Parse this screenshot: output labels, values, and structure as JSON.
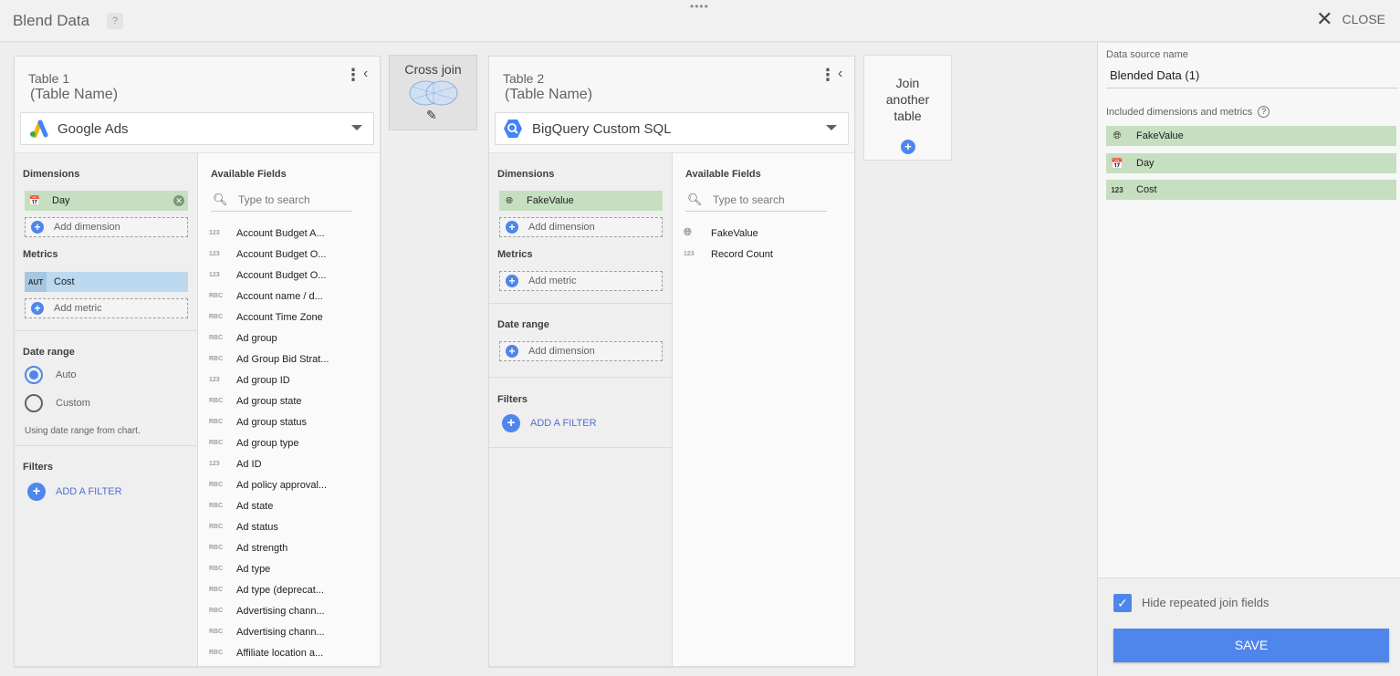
{
  "header": {
    "title": "Blend Data",
    "help_label": "?",
    "grip": "••••",
    "close_label": "CLOSE"
  },
  "table1": {
    "label": "Table 1",
    "name": "(Table Name)",
    "data_source": "Google Ads",
    "dimensions_label": "Dimensions",
    "dimensions": [
      {
        "label": "Day"
      }
    ],
    "add_dimension_label": "Add dimension",
    "metrics_label": "Metrics",
    "metrics": [
      {
        "type": "AUT",
        "label": "Cost"
      }
    ],
    "add_metric_label": "Add metric",
    "date_range_label": "Date range",
    "date_range_options": [
      "Auto",
      "Custom"
    ],
    "date_range_selected": "Auto",
    "date_range_hint": "Using date range from chart.",
    "filters_label": "Filters",
    "add_filter_label": "ADD A FILTER",
    "available_fields_label": "Available Fields",
    "search_placeholder": "Type to search",
    "fields": [
      {
        "type": "123",
        "name": "Account Budget A..."
      },
      {
        "type": "123",
        "name": "Account Budget O..."
      },
      {
        "type": "123",
        "name": "Account Budget O..."
      },
      {
        "type": "RBC",
        "name": "Account name / d..."
      },
      {
        "type": "RBC",
        "name": "Account Time Zone"
      },
      {
        "type": "RBC",
        "name": "Ad group"
      },
      {
        "type": "RBC",
        "name": "Ad Group Bid Strat..."
      },
      {
        "type": "123",
        "name": "Ad group ID"
      },
      {
        "type": "RBC",
        "name": "Ad group state"
      },
      {
        "type": "RBC",
        "name": "Ad group status"
      },
      {
        "type": "RBC",
        "name": "Ad group type"
      },
      {
        "type": "123",
        "name": "Ad ID"
      },
      {
        "type": "RBC",
        "name": "Ad policy approval..."
      },
      {
        "type": "RBC",
        "name": "Ad state"
      },
      {
        "type": "RBC",
        "name": "Ad status"
      },
      {
        "type": "RBC",
        "name": "Ad strength"
      },
      {
        "type": "RBC",
        "name": "Ad type"
      },
      {
        "type": "RBC",
        "name": "Ad type (deprecat..."
      },
      {
        "type": "RBC",
        "name": "Advertising chann..."
      },
      {
        "type": "RBC",
        "name": "Advertising chann..."
      },
      {
        "type": "RBC",
        "name": "Affiliate location a..."
      }
    ]
  },
  "join": {
    "label": "Cross join"
  },
  "table2": {
    "label": "Table 2",
    "name": "(Table Name)",
    "data_source": "BigQuery Custom SQL",
    "dimensions_label": "Dimensions",
    "dimensions": [
      {
        "label": "FakeValue"
      }
    ],
    "add_dimension_label": "Add dimension",
    "metrics_label": "Metrics",
    "add_metric_label": "Add metric",
    "date_range_label": "Date range",
    "add_date_dimension_label": "Add dimension",
    "filters_label": "Filters",
    "add_filter_label": "ADD A FILTER",
    "available_fields_label": "Available Fields",
    "search_placeholder": "Type to search",
    "fields": [
      {
        "type": "globe",
        "name": "FakeValue"
      },
      {
        "type": "123",
        "name": "Record Count"
      }
    ]
  },
  "join_another": {
    "label_line1": "Join",
    "label_line2": "another",
    "label_line3": "table"
  },
  "sidebar": {
    "data_source_name_label": "Data source name",
    "data_source_name": "Blended Data (1)",
    "included_label": "Included dimensions and metrics",
    "included": [
      {
        "type": "globe",
        "label": "FakeValue"
      },
      {
        "type": "date",
        "label": "Day"
      },
      {
        "type": "123",
        "label": "Cost"
      }
    ],
    "hide_repeated_label": "Hide repeated join fields",
    "hide_repeated_checked": true,
    "save_label": "SAVE"
  },
  "colors": {
    "accent": "#4f86ec",
    "dimension_chip": "#c5dfc0",
    "metric_chip": "#bcd9ef"
  }
}
